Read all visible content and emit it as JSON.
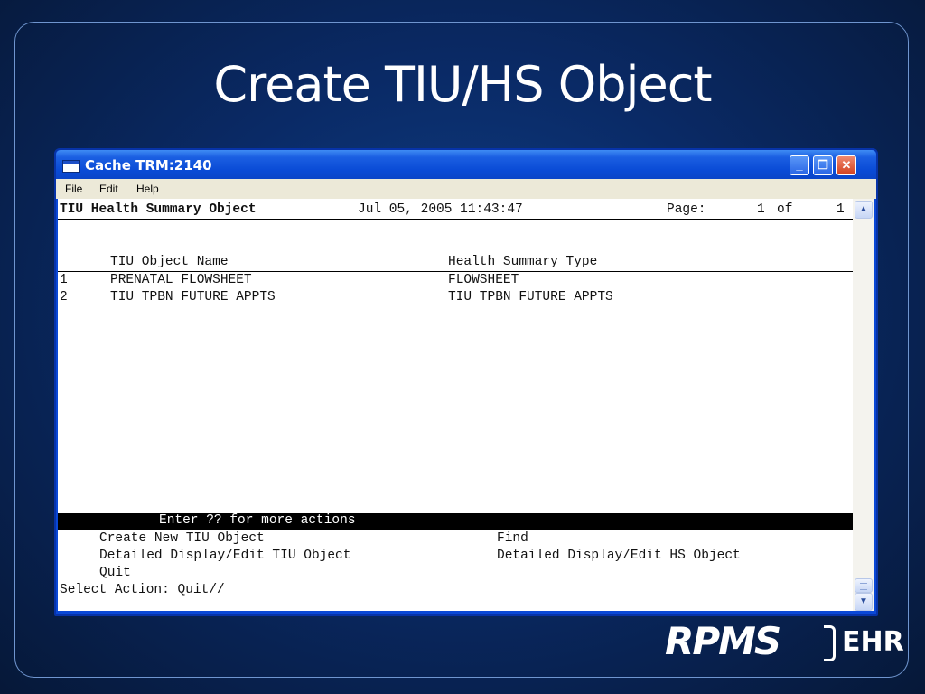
{
  "slide": {
    "title": "Create TIU/HS Object"
  },
  "window": {
    "title": "Cache TRM:2140",
    "menu": [
      "File",
      "Edit",
      "Help"
    ]
  },
  "terminal": {
    "header": {
      "screen_title": "TIU Health Summary Object",
      "timestamp": "Jul 05, 2005 11:43:47",
      "page_label": "Page:",
      "page_current": "1",
      "page_of": "of",
      "page_total": "1"
    },
    "columns": [
      "TIU Object Name",
      "Health Summary Type"
    ],
    "rows": [
      {
        "num": "1",
        "name": "PRENATAL FLOWSHEET",
        "type": "FLOWSHEET"
      },
      {
        "num": "2",
        "name": "TIU TPBN FUTURE APPTS",
        "type": "TIU TPBN FUTURE APPTS"
      }
    ],
    "action_bar": "Enter ?? for more actions",
    "actions_left": [
      "Create New TIU Object",
      "Detailed Display/Edit TIU Object",
      "Quit"
    ],
    "actions_right": [
      "Find",
      "Detailed Display/Edit HS Object"
    ],
    "prompt": "Select Action: Quit//"
  },
  "logo": {
    "rpms": "RPMS",
    "ehr": "EHR"
  },
  "icons": {
    "window_icon": "terminal-window-icon",
    "scroll_up": "chevron-up-icon",
    "scroll_down": "chevron-down-icon"
  }
}
